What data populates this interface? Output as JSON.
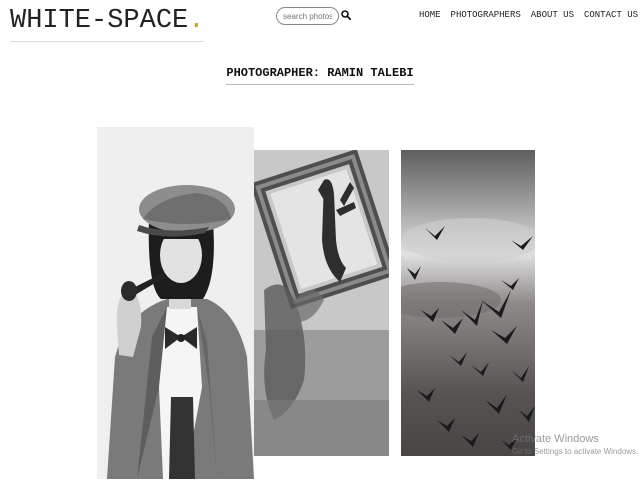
{
  "logo": {
    "text": "WHITE-SPACE",
    "dot": ".",
    "accent_color": "#c9a227"
  },
  "search": {
    "placeholder": "search photos....",
    "icon": "search-icon"
  },
  "nav": {
    "items": [
      "HOME",
      "PHOTOGRAPHERS",
      "ABOUT US",
      "CONTACT US"
    ]
  },
  "page_title": "PHOTOGRAPHER: RAMIN TALEBI",
  "photos": [
    {
      "subject": "woman in tweed cap and jacket holding a pipe, black and white portrait"
    },
    {
      "subject": "hand reaching through a gilded mirror frame, black and white"
    },
    {
      "subject": "flock of birds against a cloudy sky, black and white"
    }
  ],
  "watermark": {
    "line1": "Activate Windows",
    "line2": "Go to Settings to activate Windows."
  }
}
